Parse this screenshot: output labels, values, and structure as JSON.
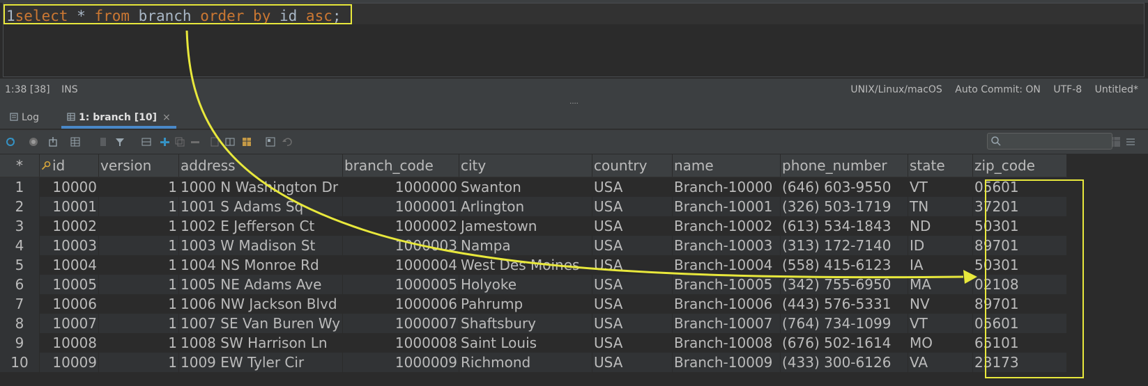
{
  "editor": {
    "line_number": "1",
    "sql": [
      {
        "text": "select",
        "cls": "kw"
      },
      {
        "text": " * ",
        "cls": "op"
      },
      {
        "text": "from",
        "cls": "kw"
      },
      {
        "text": " branch ",
        "cls": "id"
      },
      {
        "text": "order by",
        "cls": "kw"
      },
      {
        "text": " id ",
        "cls": "id"
      },
      {
        "text": "asc",
        "cls": "kw"
      },
      {
        "text": ";",
        "cls": "op"
      }
    ]
  },
  "status": {
    "position": "1:38 [38]",
    "mode": "INS",
    "line_endings": "UNIX/Linux/macOS",
    "auto_commit": "Auto Commit: ON",
    "encoding": "UTF-8",
    "file": "Untitled*"
  },
  "splitter": "....",
  "tabs": {
    "log": "Log",
    "result": "1: branch [10]",
    "close": "×"
  },
  "colors": {
    "annotation": "#e8e83c",
    "tab_underline": "#4a88c7",
    "keyword": "#cc7832"
  },
  "table": {
    "corner": "*",
    "columns": [
      "id",
      "version",
      "address",
      "branch_code",
      "city",
      "country",
      "name",
      "phone_number",
      "state",
      "zip_code"
    ],
    "rows": [
      [
        "1",
        "10000",
        "1",
        "1000 N Washington Dr",
        "1000000",
        "Swanton",
        "USA",
        "Branch-10000",
        "(646) 603-9550",
        "VT",
        "05601"
      ],
      [
        "2",
        "10001",
        "1",
        "1001 S Adams Sq",
        "1000001",
        "Arlington",
        "USA",
        "Branch-10001",
        "(326) 503-1719",
        "TN",
        "37201"
      ],
      [
        "3",
        "10002",
        "1",
        "1002 E Jefferson Ct",
        "1000002",
        "Jamestown",
        "USA",
        "Branch-10002",
        "(613) 534-1843",
        "ND",
        "50301"
      ],
      [
        "4",
        "10003",
        "1",
        "1003 W Madison St",
        "1000003",
        "Nampa",
        "USA",
        "Branch-10003",
        "(313) 172-7140",
        "ID",
        "89701"
      ],
      [
        "5",
        "10004",
        "1",
        "1004 NS Monroe Rd",
        "1000004",
        "West Des Moines",
        "USA",
        "Branch-10004",
        "(558) 415-6123",
        "IA",
        "50301"
      ],
      [
        "6",
        "10005",
        "1",
        "1005 NE Adams Ave",
        "1000005",
        "Holyoke",
        "USA",
        "Branch-10005",
        "(342) 755-6950",
        "MA",
        "02108"
      ],
      [
        "7",
        "10006",
        "1",
        "1006 NW Jackson Blvd",
        "1000006",
        "Pahrump",
        "USA",
        "Branch-10006",
        "(443) 576-5331",
        "NV",
        "89701"
      ],
      [
        "8",
        "10007",
        "1",
        "1007 SE Van Buren Wy",
        "1000007",
        "Shaftsbury",
        "USA",
        "Branch-10007",
        "(764) 734-1099",
        "VT",
        "05601"
      ],
      [
        "9",
        "10008",
        "1",
        "1008 SW Harrison Ln",
        "1000008",
        "Saint Louis",
        "USA",
        "Branch-10008",
        "(676) 502-1614",
        "MO",
        "65101"
      ],
      [
        "10",
        "10009",
        "1",
        "1009 EW Tyler Cir",
        "1000009",
        "Richmond",
        "USA",
        "Branch-10009",
        "(433) 300-6126",
        "VA",
        "23173"
      ]
    ]
  }
}
